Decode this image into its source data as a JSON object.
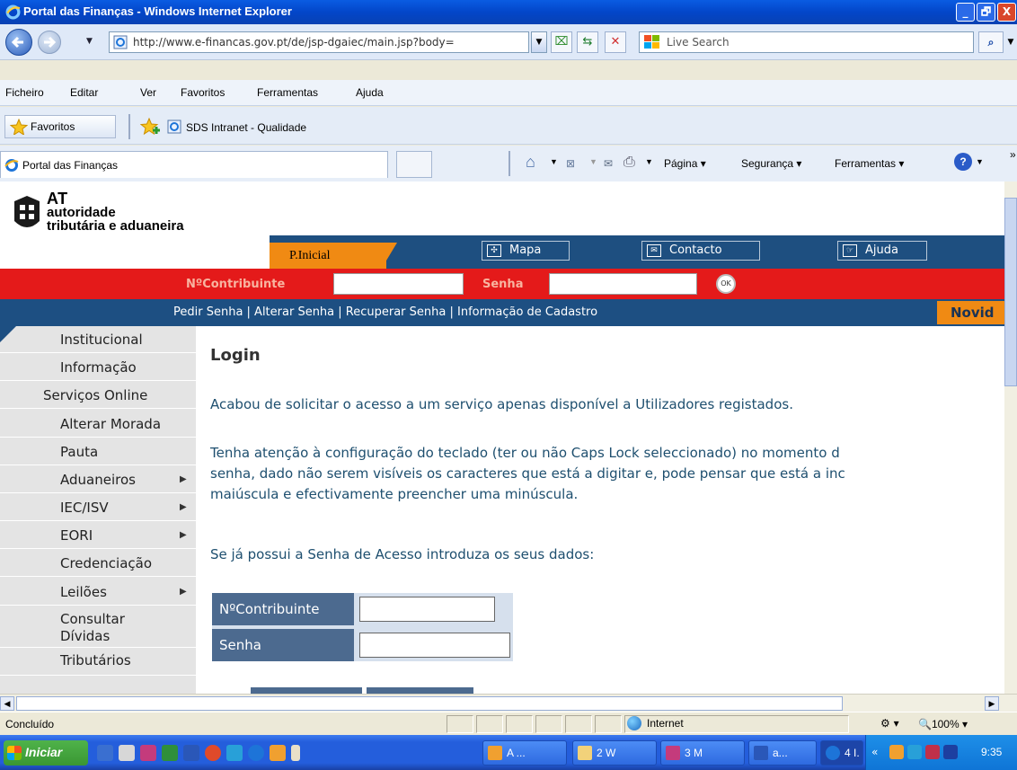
{
  "window": {
    "title": "Portal das Finanças - Windows Internet Explorer",
    "btn_min": "_",
    "btn_max": "🗗",
    "btn_close": "X"
  },
  "address_bar": {
    "url": "http://www.e-financas.gov.pt/de/jsp-dgaiec/main.jsp?body=",
    "search_placeholder": "Live Search"
  },
  "menu": [
    "Ficheiro",
    "Editar",
    "Ver",
    "Favoritos",
    "Ferramentas",
    "Ajuda"
  ],
  "favorites_bar": {
    "favorites_label": "Favoritos",
    "link": "SDS Intranet - Qualidade"
  },
  "tab": {
    "label": "Portal das Finanças"
  },
  "command_bar": {
    "page": "Página",
    "security": "Segurança",
    "tools": "Ferramentas"
  },
  "site": {
    "logo": {
      "line1": "AT",
      "line2": "autoridade",
      "line3": "tributária e aduaneira"
    },
    "nav": {
      "home": "P.Inicial",
      "map": "Mapa",
      "contact": "Contacto",
      "help": "Ajuda"
    },
    "login_bar": {
      "nif_label": "NºContribuinte",
      "password_label": "Senha",
      "ok_label": "OK"
    },
    "links": "Pedir Senha | Alterar Senha | Recuperar Senha | Informação de Cadastro",
    "news": "Novid"
  },
  "sidebar": [
    {
      "label": "Institucional",
      "arrow": false
    },
    {
      "label": "Informação",
      "arrow": false
    },
    {
      "label": "Serviços Online",
      "arrow": false
    },
    {
      "label": "Alterar Morada",
      "arrow": false
    },
    {
      "label": "Pauta",
      "arrow": false
    },
    {
      "label": "Aduaneiros",
      "arrow": true
    },
    {
      "label": "IEC/ISV",
      "arrow": true
    },
    {
      "label": "EORI",
      "arrow": true
    },
    {
      "label": "Credenciação",
      "arrow": false
    },
    {
      "label": "Leilões",
      "arrow": true
    },
    {
      "label": "Consultar Dívidas",
      "arrow": false
    },
    {
      "label": "Tributários",
      "arrow": false
    }
  ],
  "main": {
    "title": "Login",
    "para1": "Acabou de solicitar o acesso a um serviço apenas disponível a Utilizadores registados.",
    "para2_line1": "Tenha atenção à configuração do teclado (ter ou não Caps Lock seleccionado) no momento d",
    "para2_line2": "senha, dado não serem visíveis os caracteres que está a digitar e, pode pensar que está a inc",
    "para2_line3": "maiúscula e efectivamente preencher uma minúscula.",
    "para3": "Se já possui a Senha de Acesso introduza os seus dados:",
    "form": {
      "nif_label": "NºContribuinte",
      "password_label": "Senha"
    }
  },
  "status": {
    "text": "Concluído",
    "zone": "Internet",
    "zoom": "100%"
  },
  "taskbar": {
    "start": "Iniciar",
    "tasks": [
      "A ...",
      "2 W",
      "3 M",
      "a...",
      "4 I."
    ],
    "clock": "9:35"
  }
}
